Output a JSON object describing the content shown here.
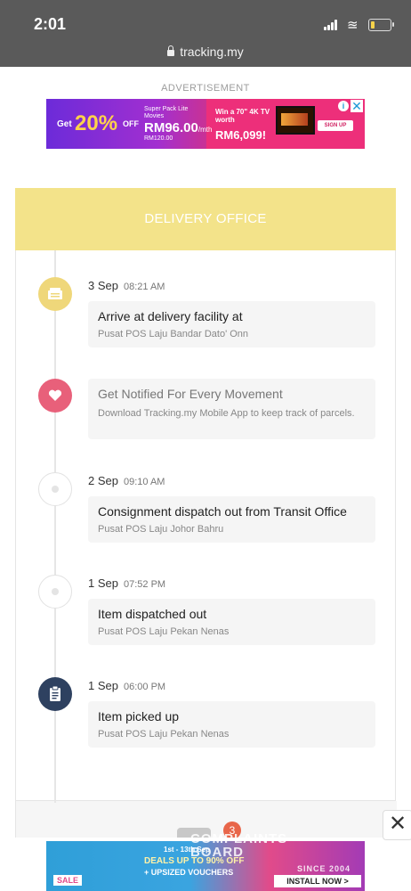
{
  "status_bar": {
    "time": "2:01",
    "url": "tracking.my"
  },
  "advertisement": {
    "label": "ADVERTISEMENT",
    "get": "Get",
    "percent": "20%",
    "off": "OFF",
    "pack": "Super Pack Lite Movies",
    "price": "RM96.00",
    "per_month": "/mth",
    "was": "RM120.00",
    "win": "Win a 70\" 4K TV worth",
    "tv_price": "RM6,099!",
    "signup": "SIGN UP",
    "info_icon": "i",
    "close_icon": "✕"
  },
  "card": {
    "header": "DELIVERY OFFICE"
  },
  "timeline": [
    {
      "date": "3 Sep",
      "time": "08:21 AM",
      "title": "Arrive at delivery facility at",
      "location": "Pusat POS Laju Bandar Dato' Onn",
      "icon": "building-icon"
    },
    {
      "date": "",
      "time": "",
      "title": "Get Notified For Every Movement",
      "location": "Download Tracking.my Mobile App to keep track of parcels.",
      "icon": "heart-icon"
    },
    {
      "date": "2 Sep",
      "time": "09:10 AM",
      "title": "Consignment dispatch out from Transit Office",
      "location": "Pusat POS Laju Johor Bahru",
      "icon": "dot-icon"
    },
    {
      "date": "1 Sep",
      "time": "07:52 PM",
      "title": "Item dispatched out",
      "location": "Pusat POS Laju Pekan Nenas",
      "icon": "dot-icon"
    },
    {
      "date": "1 Sep",
      "time": "06:00 PM",
      "title": "Item picked up",
      "location": "Pusat POS Laju Pekan Nenas",
      "icon": "clipboard-icon"
    }
  ],
  "bottom": {
    "badge_count": "3",
    "close_icon": "✕",
    "watermark_line1": "COMPLAINTS",
    "watermark_line2": "BOARD",
    "watermark_line3": "SINCE 2004",
    "ad": {
      "dates": "1st - 13th Sep",
      "line1": "DEALS UP TO 90% OFF",
      "line2": "+ UPSIZED VOUCHERS",
      "sale": "SALE",
      "install": "INSTALL NOW >"
    }
  },
  "colors": {
    "header_bg": "#f3e38a",
    "yellow_dot": "#efd77a",
    "pink_dot": "#e8607a",
    "navy_dot": "#2e4160"
  }
}
